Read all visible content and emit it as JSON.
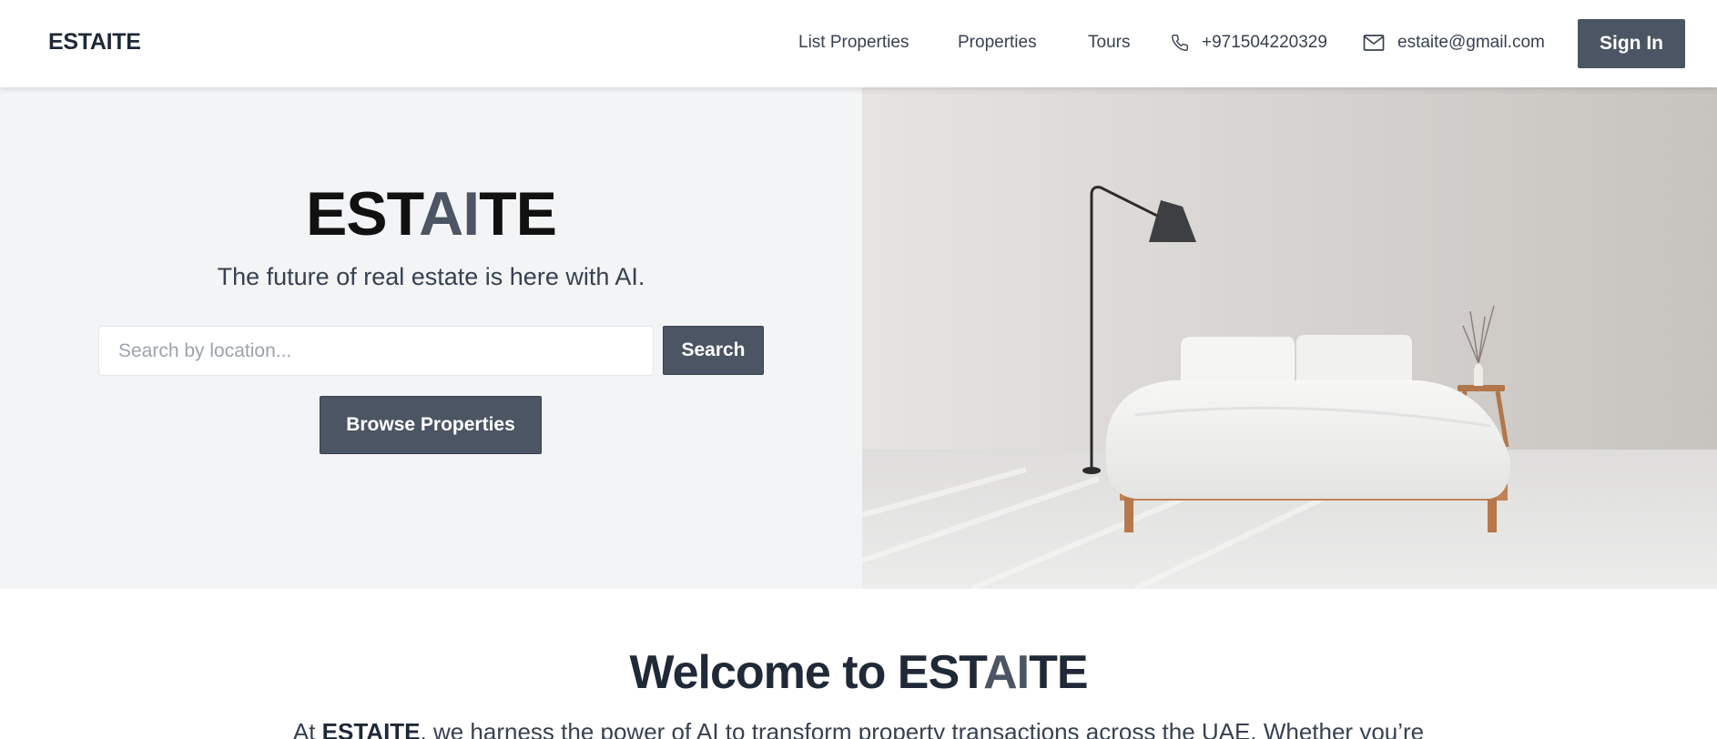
{
  "header": {
    "brand": "ESTAITE",
    "nav": [
      "List Properties",
      "Properties",
      "Tours"
    ],
    "phone": "+971504220329",
    "email": "estaite@gmail.com",
    "sign_in": "Sign In"
  },
  "hero": {
    "title_prefix": "EST",
    "title_highlight": "AI",
    "title_suffix": "TE",
    "subtitle": "The future of real estate is here with AI.",
    "search_placeholder": "Search by location...",
    "search_button": "Search",
    "browse_button": "Browse Properties"
  },
  "welcome": {
    "title_prefix": "Welcome to EST",
    "title_highlight": "AI",
    "title_suffix": "TE",
    "text_prefix": "At ",
    "text_brand": "ESTAITE",
    "text_rest": ", we harness the power of AI to transform property transactions across the UAE. Whether you’re"
  },
  "colors": {
    "accent": "#4b5563",
    "hero_bg": "#f3f4f6",
    "text_dark": "#1f2937"
  },
  "icons": {
    "phone": "phone-icon",
    "email": "mail-icon"
  }
}
